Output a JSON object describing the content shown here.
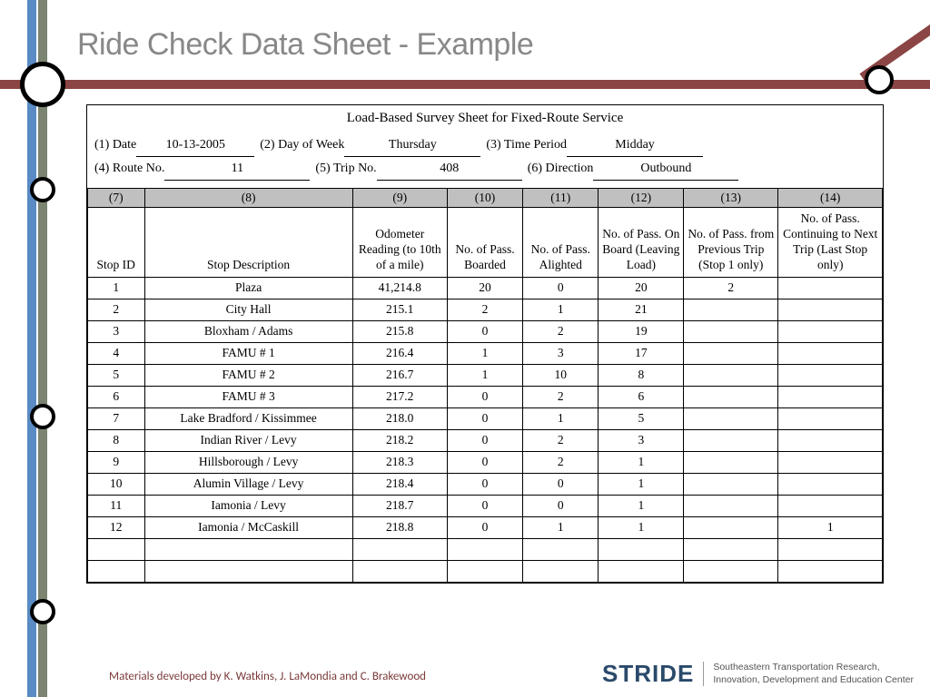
{
  "title": "Ride Check Data Sheet - Example",
  "sheet_title": "Load-Based Survey Sheet for Fixed-Route Service",
  "meta": {
    "date_label": "(1) Date",
    "date_val": "10-13-2005",
    "dow_label": "(2) Day of Week",
    "dow_val": "Thursday",
    "period_label": "(3) Time Period",
    "period_val": "Midday",
    "route_label": "(4) Route No.",
    "route_val": "11",
    "trip_label": "(5) Trip No.",
    "trip_val": "408",
    "dir_label": "(6) Direction",
    "dir_val": "Outbound"
  },
  "colnums": [
    "(7)",
    "(8)",
    "(9)",
    "(10)",
    "(11)",
    "(12)",
    "(13)",
    "(14)"
  ],
  "headers": [
    "Stop ID",
    "Stop Description",
    "Odometer Reading (to 10th of a mile)",
    "No. of Pass. Boarded",
    "No. of Pass. Alighted",
    "No. of Pass. On Board (Leaving Load)",
    "No. of Pass. from Previous Trip (Stop 1 only)",
    "No. of Pass. Continuing to Next Trip (Last Stop only)"
  ],
  "rows": [
    {
      "id": "1",
      "desc": "Plaza",
      "odo": "41,214.8",
      "board": "20",
      "alight": "0",
      "load": "20",
      "prev": "2",
      "next": ""
    },
    {
      "id": "2",
      "desc": "City Hall",
      "odo": "215.1",
      "board": "2",
      "alight": "1",
      "load": "21",
      "prev": "",
      "next": ""
    },
    {
      "id": "3",
      "desc": "Bloxham / Adams",
      "odo": "215.8",
      "board": "0",
      "alight": "2",
      "load": "19",
      "prev": "",
      "next": ""
    },
    {
      "id": "4",
      "desc": "FAMU # 1",
      "odo": "216.4",
      "board": "1",
      "alight": "3",
      "load": "17",
      "prev": "",
      "next": ""
    },
    {
      "id": "5",
      "desc": "FAMU # 2",
      "odo": "216.7",
      "board": "1",
      "alight": "10",
      "load": "8",
      "prev": "",
      "next": ""
    },
    {
      "id": "6",
      "desc": "FAMU # 3",
      "odo": "217.2",
      "board": "0",
      "alight": "2",
      "load": "6",
      "prev": "",
      "next": ""
    },
    {
      "id": "7",
      "desc": "Lake Bradford / Kissimmee",
      "odo": "218.0",
      "board": "0",
      "alight": "1",
      "load": "5",
      "prev": "",
      "next": ""
    },
    {
      "id": "8",
      "desc": "Indian River / Levy",
      "odo": "218.2",
      "board": "0",
      "alight": "2",
      "load": "3",
      "prev": "",
      "next": ""
    },
    {
      "id": "9",
      "desc": "Hillsborough / Levy",
      "odo": "218.3",
      "board": "0",
      "alight": "2",
      "load": "1",
      "prev": "",
      "next": ""
    },
    {
      "id": "10",
      "desc": "Alumin Village / Levy",
      "odo": "218.4",
      "board": "0",
      "alight": "0",
      "load": "1",
      "prev": "",
      "next": ""
    },
    {
      "id": "11",
      "desc": "Iamonia / Levy",
      "odo": "218.7",
      "board": "0",
      "alight": "0",
      "load": "1",
      "prev": "",
      "next": ""
    },
    {
      "id": "12",
      "desc": "Iamonia / McCaskill",
      "odo": "218.8",
      "board": "0",
      "alight": "1",
      "load": "1",
      "prev": "",
      "next": "1"
    },
    {
      "id": "",
      "desc": "",
      "odo": "",
      "board": "",
      "alight": "",
      "load": "",
      "prev": "",
      "next": ""
    },
    {
      "id": "",
      "desc": "",
      "odo": "",
      "board": "",
      "alight": "",
      "load": "",
      "prev": "",
      "next": ""
    }
  ],
  "footer": "Materials developed by K. Watkins, J. LaMondia and C. Brakewood",
  "stride": {
    "logo": "STRIDE",
    "line1": "Southeastern Transportation Research,",
    "line2": "Innovation, Development and Education Center"
  }
}
